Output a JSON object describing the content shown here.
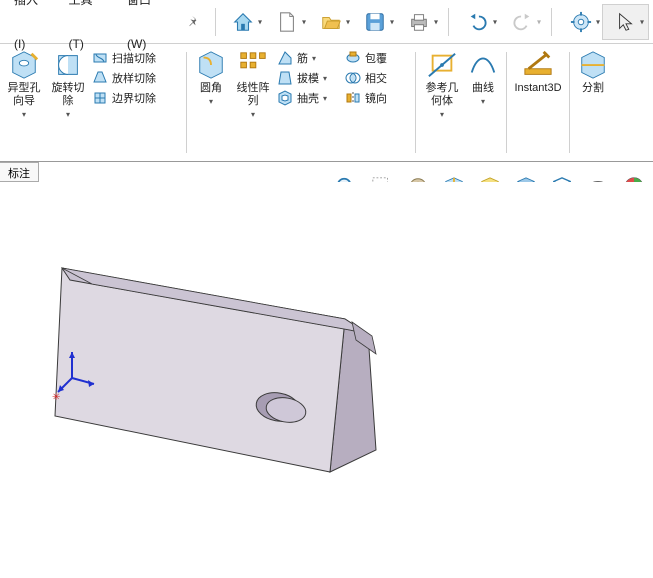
{
  "menubar": {
    "items": [
      {
        "label": "插入(I)"
      },
      {
        "label": "工具(T)"
      },
      {
        "label": "窗口(W)"
      }
    ]
  },
  "qat": {
    "home_tip": "主页",
    "new_tip": "新建",
    "open_tip": "打开",
    "save_tip": "保存",
    "print_tip": "打印",
    "undo_tip": "撤销",
    "redo_tip": "重做",
    "settings_tip": "选项"
  },
  "ribbon": {
    "holeWizard": "异型孔\n向导",
    "revolveCut": "旋转切\n除",
    "sweepCut": "扫描切除",
    "loftCut": "放样切除",
    "boundaryCut": "边界切除",
    "fillet": "圆角",
    "linearPattern": "线性阵\n列",
    "rib": "筋",
    "draft": "拔模",
    "shell": "抽壳",
    "wrap": "包覆",
    "intersect": "相交",
    "mirror": "镜向",
    "refGeom": "参考几\n何体",
    "curves": "曲线",
    "instant3d": "Instant3D",
    "split": "分割"
  },
  "tabs": {
    "annotate": "标注"
  },
  "viewToolbar": {
    "zoomFit": "缩放匹配",
    "zoomArea": "区域缩放",
    "prevView": "上一视图",
    "sectionView": "剖面视图",
    "viewOrient": "视图定向",
    "displayStyle": "显示样式",
    "hideShow": "隐藏/显示",
    "appearance": "外观"
  }
}
